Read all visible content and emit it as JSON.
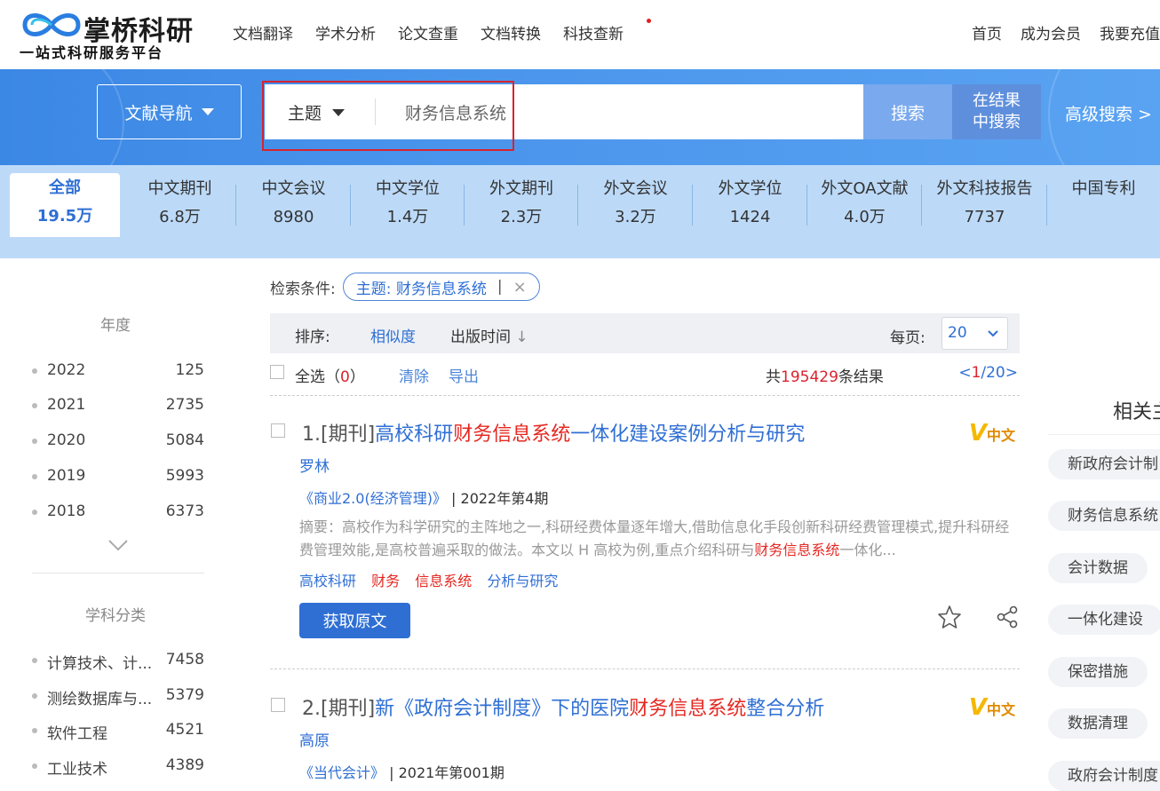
{
  "brand": {
    "name": "掌桥科研",
    "slogan": "一站式科研服务平台"
  },
  "topnav": [
    "文档翻译",
    "学术分析",
    "论文查重",
    "文档转换",
    "科技查新"
  ],
  "rightnav": [
    "首页",
    "成为会员",
    "我要充值"
  ],
  "search": {
    "nav_button": "文献导航",
    "field": "主题",
    "query": "财务信息系统",
    "search_button": "搜索",
    "within_line1": "在结果",
    "within_line2": "中搜索",
    "advanced": "高级搜索 >"
  },
  "db_tabs": [
    {
      "name": "全部",
      "count": "19.5万"
    },
    {
      "name": "中文期刊",
      "count": "6.8万"
    },
    {
      "name": "中文会议",
      "count": "8980"
    },
    {
      "name": "中文学位",
      "count": "1.4万"
    },
    {
      "name": "外文期刊",
      "count": "2.3万"
    },
    {
      "name": "外文会议",
      "count": "3.2万"
    },
    {
      "name": "外文学位",
      "count": "1424"
    },
    {
      "name": "外文OA文献",
      "count": "4.0万"
    },
    {
      "name": "外文科技报告",
      "count": "7737"
    },
    {
      "name": "中国专利",
      "count": ""
    }
  ],
  "sidebar": {
    "year_title": "年度",
    "years": [
      {
        "label": "2022",
        "count": "125"
      },
      {
        "label": "2021",
        "count": "2735"
      },
      {
        "label": "2020",
        "count": "5084"
      },
      {
        "label": "2019",
        "count": "5993"
      },
      {
        "label": "2018",
        "count": "6373"
      }
    ],
    "subject_title": "学科分类",
    "subjects": [
      {
        "label": "计算技术、计...",
        "count": "7458"
      },
      {
        "label": "测绘数据库与...",
        "count": "5379"
      },
      {
        "label": "软件工程",
        "count": "4521"
      },
      {
        "label": "工业技术",
        "count": "4389"
      }
    ]
  },
  "conditions": {
    "label": "检索条件:",
    "tag": "主题: 财务信息系统",
    "sep": "|",
    "close": "×"
  },
  "sort": {
    "label": "排序:",
    "relevance": "相似度",
    "pubtime": "出版时间",
    "arrow": "↓",
    "per_page_label": "每页:",
    "per_page": "20"
  },
  "select": {
    "all_text": "全选（",
    "all_count": "0",
    "all_close": "）",
    "clear": "清除",
    "export": "导出",
    "total_prefix": "共",
    "total": "195429",
    "total_suffix": "条结果",
    "page_prev": "<",
    "page_cur": "1",
    "page_total": "/20",
    "page_next": ">"
  },
  "results": [
    {
      "index": "1.[期刊]",
      "title_pre": "高校科研",
      "title_hl": "财务信息系统",
      "title_post": "一体化建设案例分析与研究",
      "badge_v": "V",
      "badge_cn": "中文",
      "author": "罗林",
      "journal": "《商业2.0(经济管理)》",
      "issue": "| 2022年第4期",
      "abstract_pre": "摘要：高校作为科学研究的主阵地之一,科研经费体量逐年增大,借助信息化手段创新科研经费管理模式,提升科研经费管理效能,是高校普遍采取的做法。本文以 H 高校为例,重点介绍科研与",
      "abstract_hl": "财务信息系统",
      "abstract_post": "一体化...",
      "keywords": [
        {
          "text": "高校科研",
          "hl": false
        },
        {
          "text": "财务",
          "hl": true
        },
        {
          "text": "信息系统",
          "hl": true
        },
        {
          "text": "分析与研究",
          "hl": false
        }
      ],
      "button": "获取原文"
    },
    {
      "index": "2.[期刊]",
      "title_pre": "新《政府会计制度》下的医院",
      "title_hl": "财务信息系统",
      "title_post": "整合分析",
      "badge_v": "V",
      "badge_cn": "中文",
      "author": "高原",
      "journal": "《当代会计》",
      "issue": "| 2021年第001期"
    }
  ],
  "related": {
    "title": "相关主",
    "tags": [
      "新政府会计制",
      "财务信息系统",
      "会计数据",
      "一体化建设",
      "保密措施",
      "数据清理",
      "政府会计制度"
    ]
  },
  "colors": {
    "primary": "#2f6fd4",
    "highlight": "#e52822",
    "banner": "#4a95ec",
    "tabs_bg": "#bcdaf8"
  }
}
